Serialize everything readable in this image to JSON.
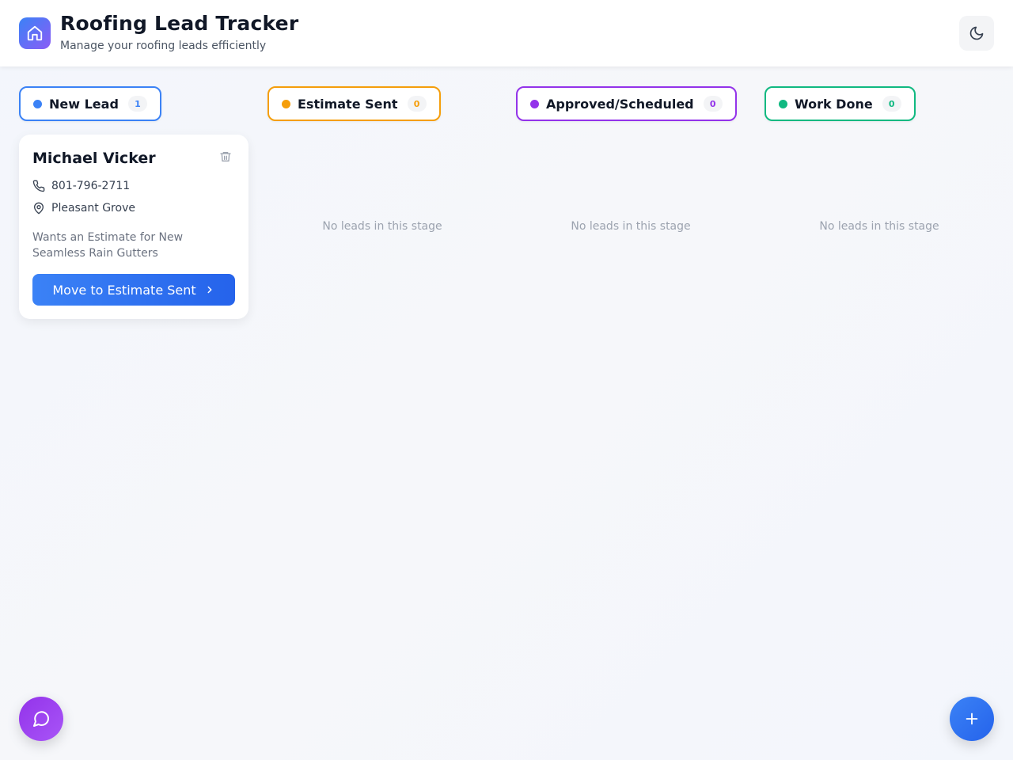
{
  "header": {
    "title": "Roofing Lead Tracker",
    "subtitle": "Manage your roofing leads efficiently",
    "logo_icon": "home-icon",
    "theme_toggle_icon": "moon-icon"
  },
  "stages": [
    {
      "label": "New Lead",
      "count": "1",
      "color": "#3b82f6"
    },
    {
      "label": "Estimate Sent",
      "count": "0",
      "color": "#f59e0b"
    },
    {
      "label": "Approved/Scheduled",
      "count": "0",
      "color": "#9333ea"
    },
    {
      "label": "Work Done",
      "count": "0",
      "color": "#10b981"
    }
  ],
  "empty_message": "No leads in this stage",
  "lead": {
    "name": "Michael Vicker",
    "phone": "801-796-2711",
    "location": "Pleasant Grove",
    "notes": "Wants an Estimate for New Seamless Rain Gutters",
    "action_label": "Move to Estimate Sent"
  },
  "fabs": {
    "chat_icon": "message-circle-icon",
    "add_icon": "plus-icon"
  },
  "colors": {
    "accent": "#3b82f6",
    "chat_fab": "#9333ea"
  }
}
